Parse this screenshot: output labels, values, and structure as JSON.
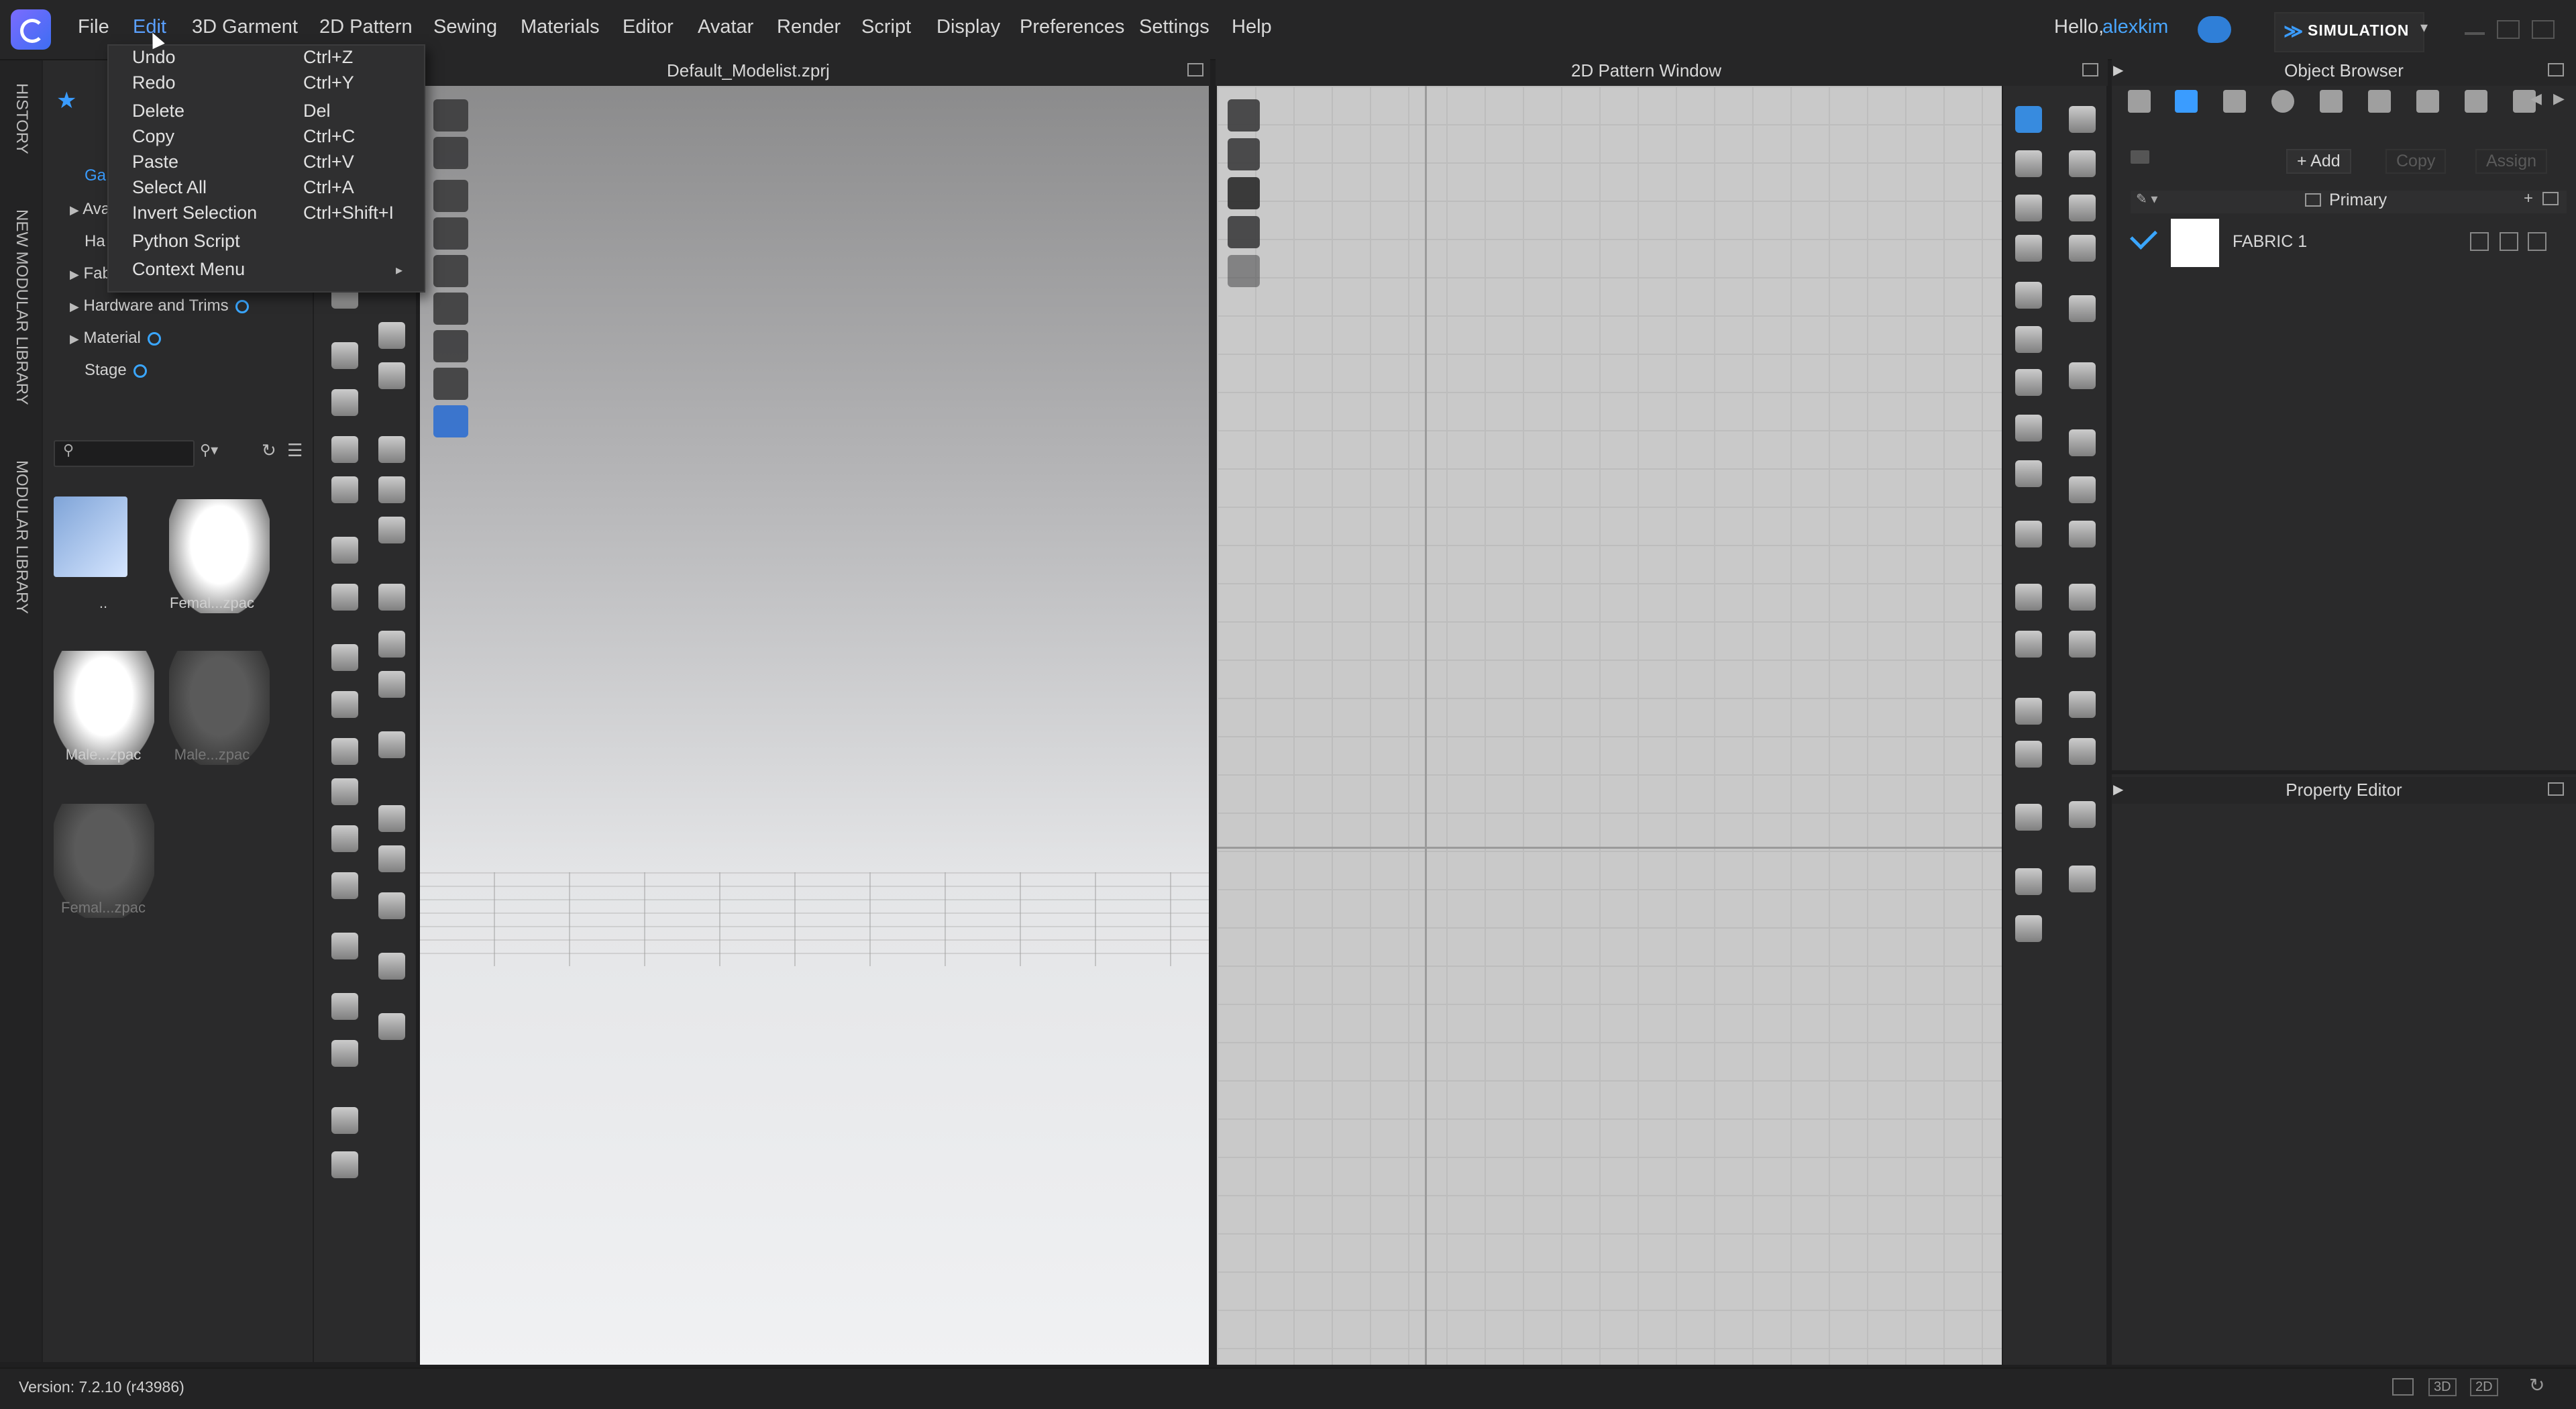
{
  "menubar": {
    "items": [
      "File",
      "Edit",
      "3D Garment",
      "2D Pattern",
      "Sewing",
      "Materials",
      "Editor",
      "Avatar",
      "Render",
      "Script",
      "Display",
      "Preferences",
      "Settings",
      "Help"
    ],
    "active": "Edit",
    "greeting": "Hello,",
    "username": "alexkim",
    "mode": "SIMULATION"
  },
  "vertical_tabs": [
    "HISTORY",
    "NEW MODULAR LIBRARY",
    "MODULAR LIBRARY"
  ],
  "edit_menu": [
    {
      "label": "Undo",
      "shortcut": "Ctrl+Z"
    },
    {
      "label": "Redo",
      "shortcut": "Ctrl+Y"
    },
    {
      "label": "Delete",
      "shortcut": "Del"
    },
    {
      "label": "Copy",
      "shortcut": "Ctrl+C"
    },
    {
      "label": "Paste",
      "shortcut": "Ctrl+V"
    },
    {
      "label": "Select All",
      "shortcut": "Ctrl+A"
    },
    {
      "label": "Invert Selection",
      "shortcut": "Ctrl+Shift+I"
    },
    {
      "label": "Python Script",
      "shortcut": ""
    },
    {
      "label": "Context Menu",
      "shortcut": ""
    }
  ],
  "library": {
    "partial_labels": [
      "Ga",
      "Ava",
      "Ha",
      "Fab"
    ],
    "tree": [
      "Hardware and Trims",
      "Material",
      "Stage"
    ],
    "files": [
      {
        "label": "..",
        "dim": false
      },
      {
        "label": "Femal...zpac",
        "dim": false
      },
      {
        "label": "Male...zpac",
        "dim": false
      },
      {
        "label": "Male...zpac",
        "dim": true
      },
      {
        "label": "Femal...zpac",
        "dim": true
      }
    ]
  },
  "viewport3d": {
    "title": "Default_Modelist.zprj"
  },
  "pattern2d": {
    "title": "2D Pattern Window"
  },
  "object_browser": {
    "title": "Object Browser",
    "add_label": "+ Add",
    "copy_label": "Copy",
    "assign_label": "Assign",
    "group_label": "Primary",
    "fabric_name": "FABRIC 1"
  },
  "property_editor": {
    "title": "Property Editor"
  },
  "status": {
    "version": "Version: 7.2.10 (r43986)"
  },
  "colors": {
    "accent": "#3a9cff",
    "username": "#49a6ff",
    "background": "#1f1f20"
  }
}
